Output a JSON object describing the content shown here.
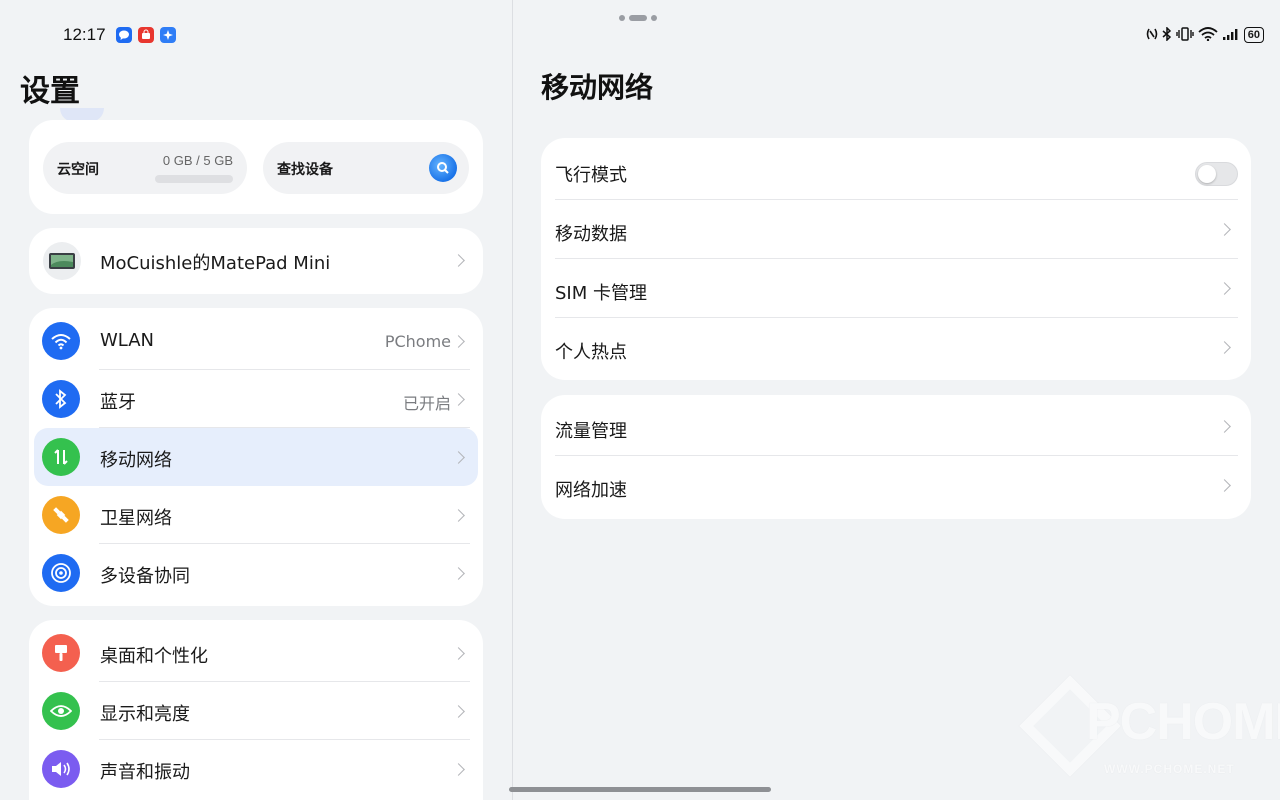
{
  "status_bar": {
    "time": "12:17",
    "battery": "60",
    "notification_icons": [
      "message-icon",
      "store-icon",
      "ai-assistant-icon"
    ],
    "status_icons": [
      "nfc-icon",
      "bluetooth-icon",
      "vibrate-icon",
      "wifi-icon",
      "cellular-signal-icon"
    ]
  },
  "left_pane": {
    "title": "设置",
    "cloud": {
      "label": "云空间",
      "usage": "0 GB / 5 GB",
      "usage_fraction": 0.0
    },
    "find_device": {
      "label": "查找设备",
      "icon": "search-device-icon"
    },
    "device": {
      "name": "MoCuishle的MatePad Mini",
      "icon": "tablet-icon"
    },
    "group1": [
      {
        "label": "WLAN",
        "value": "PChome",
        "icon": "wifi-icon",
        "color": "#1f6bf2"
      },
      {
        "label": "蓝牙",
        "value": "已开启",
        "icon": "bluetooth-icon",
        "color": "#1f6bf2"
      },
      {
        "label": "移动网络",
        "value": "",
        "icon": "mobile-data-icon",
        "color": "#34c14e",
        "selected": true
      },
      {
        "label": "卫星网络",
        "value": "",
        "icon": "satellite-icon",
        "color": "#f6a623"
      },
      {
        "label": "多设备协同",
        "value": "",
        "icon": "multi-device-icon",
        "color": "#1f6bf2"
      }
    ],
    "group2": [
      {
        "label": "桌面和个性化",
        "icon": "paint-brush-icon",
        "color": "#f4604f"
      },
      {
        "label": "显示和亮度",
        "icon": "eye-icon",
        "color": "#34c14e"
      },
      {
        "label": "声音和振动",
        "icon": "speaker-icon",
        "color": "#7b5cf0"
      }
    ]
  },
  "right_pane": {
    "title": "移动网络",
    "group1": [
      {
        "label": "飞行模式",
        "type": "toggle",
        "enabled": false
      },
      {
        "label": "移动数据",
        "type": "link"
      },
      {
        "label": "SIM 卡管理",
        "type": "link"
      },
      {
        "label": "个人热点",
        "type": "link"
      }
    ],
    "group2": [
      {
        "label": "流量管理",
        "type": "link"
      },
      {
        "label": "网络加速",
        "type": "link"
      }
    ]
  },
  "watermark": {
    "text": "PCHOME",
    "url": "WWW.PCHOME.NET"
  }
}
